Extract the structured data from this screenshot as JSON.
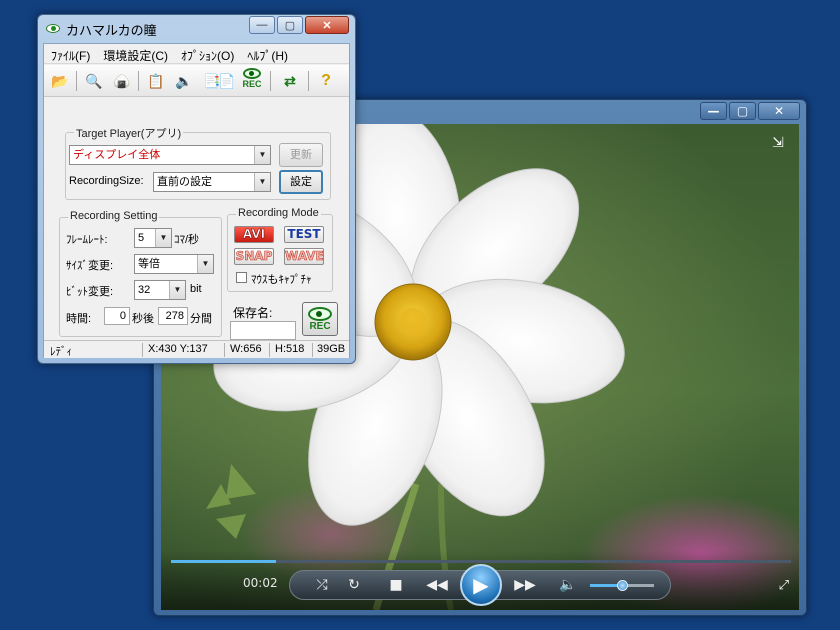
{
  "recorder": {
    "title": "カハマルカの瞳",
    "caption": {
      "minimize": "—",
      "maximize": "▢",
      "close": "✕"
    },
    "menu": [
      "ﾌｧｲﾙ(F)",
      "環境設定(C)",
      "ｵﾌﾟｼｮﾝ(O)",
      "ﾍﾙﾌﾟ(H)"
    ],
    "toolbar": {
      "open_icon": "folder-open-icon",
      "preview_icon": "magnifier-page-icon",
      "rice_ball_icon": "rice-ball-icon",
      "clipboard_icon": "clipboard-icon",
      "sound_icon": "speaker-icon",
      "copy_icon": "copy-pages-icon",
      "pages_icon": "pages-icon",
      "rec_label": "REC",
      "switch_icon": "switch-arrows-icon",
      "help_icon": "help-question-icon"
    },
    "target": {
      "group_title": "Target Player(アプリ)",
      "player_value": "ディスプレイ全体",
      "refresh_label": "更新",
      "size_label": "RecordingSize:",
      "size_value": "直前の設定",
      "settings_label": "設定"
    },
    "setting": {
      "group_title": "Recording Setting",
      "framerate_label": "ﾌﾚｰﾑﾚｰﾄ:",
      "framerate_value": "5",
      "framerate_unit": "ｺﾏ/秒",
      "size_change_label": "ｻｲｽﾞ変更:",
      "size_change_value": "等倍",
      "bit_change_label": "ﾋﾞｯﾄ変更:",
      "bit_value": "32",
      "bit_unit": "bit",
      "time_label": "時間:",
      "time_delay_value": "0",
      "time_delay_unit": "秒後",
      "time_duration_value": "278",
      "time_duration_unit": "分間"
    },
    "mode": {
      "group_title": "Recording Mode",
      "avi": "AVI",
      "test": "TEST",
      "snap": "SNAP",
      "wave": "WAVE",
      "mouse_capture": "ﾏｳｽもｷｬﾌﾟﾁｬ",
      "mouse_capture_checked": false
    },
    "save": {
      "label": "保存名:",
      "value": "",
      "rec_label": "REC"
    },
    "status": {
      "state": "ﾚﾃﾞｨ",
      "coords": "X:430 Y:137",
      "width": "W:656",
      "height": "H:518",
      "disk": "39GB"
    }
  },
  "player": {
    "caption": {
      "minimize": "—",
      "maximize": "▢",
      "close": "✕"
    },
    "time": "00:02",
    "seek_progress": 0.17,
    "volume_level": 0.5,
    "icons": {
      "shuffle": "shuffle-icon",
      "repeat": "repeat-icon",
      "stop": "stop-icon",
      "previous": "previous-icon",
      "play": "play-icon",
      "next": "next-icon",
      "mute": "speaker-icon",
      "switch_view": "switch-to-library-icon",
      "fullscreen": "fullscreen-icon"
    }
  },
  "colors": {
    "desktop": "#123f7e",
    "accent_blue": "#58b6f0",
    "rec_green": "#1c7a1c",
    "target_text": "#cc0000"
  }
}
